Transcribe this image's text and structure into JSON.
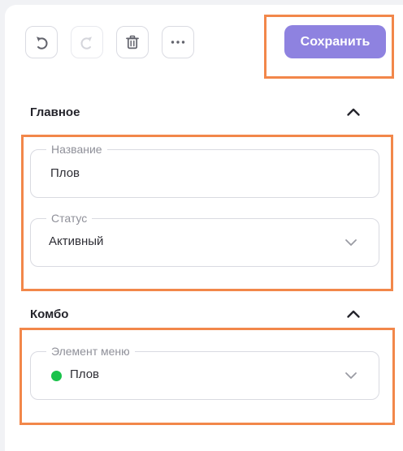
{
  "toolbar": {
    "save_label": "Сохранить",
    "icons": [
      "undo-icon",
      "redo-icon",
      "trash-icon",
      "more-dots-icon"
    ]
  },
  "main_section": {
    "title": "Главное",
    "name_field": {
      "label": "Название",
      "value": "Плов"
    },
    "status_field": {
      "label": "Статус",
      "value": "Активный"
    }
  },
  "combo_section": {
    "title": "Комбо",
    "menu_item_field": {
      "label": "Элемент меню",
      "value": "Плов",
      "status_color": "#19c24a"
    }
  },
  "colors": {
    "accent": "#8e82e0",
    "highlight": "#f2874a",
    "active_status": "#19c24a"
  }
}
